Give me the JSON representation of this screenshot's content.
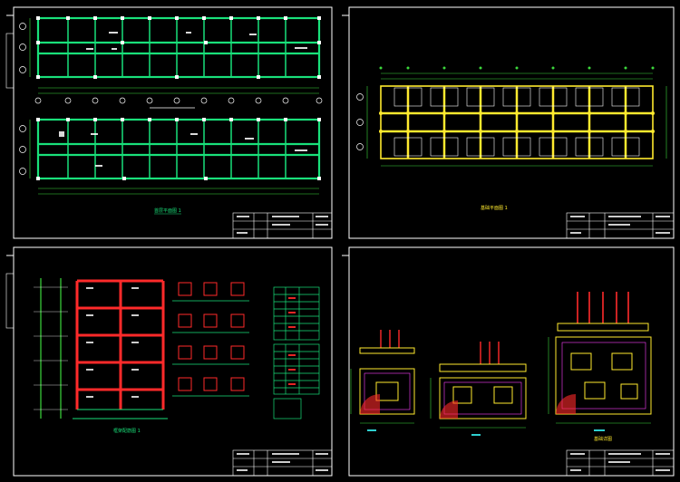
{
  "sheets": [
    {
      "id": "top-left",
      "caption": "首层平面图 1"
    },
    {
      "id": "top-right",
      "caption": "基础平面图 1"
    },
    {
      "id": "bottom-left",
      "caption": "框架配筋图 1"
    },
    {
      "id": "bottom-right",
      "caption": "基础详图"
    }
  ],
  "colors": {
    "background": "#000000",
    "border": "#ffffff",
    "wall": "#19e07a",
    "grid": "#ffffff",
    "foundation": "#ffea2e",
    "rebar": "#ff2a2a",
    "dim": "#3cd83c",
    "magenta": "#ff40ff",
    "cyan": "#33e6e6"
  }
}
